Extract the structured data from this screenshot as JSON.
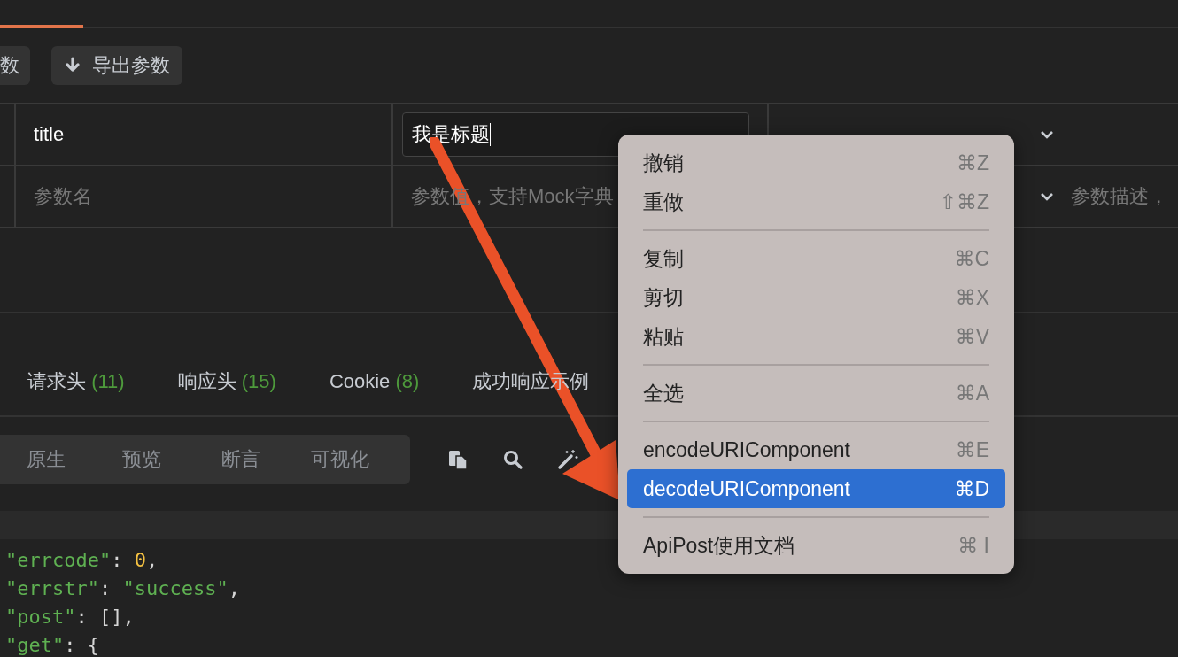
{
  "params_toolbar": {
    "buttons": [
      {
        "label": "数"
      },
      {
        "label": "导出参数"
      }
    ]
  },
  "params_table": {
    "rows": [
      {
        "kind": "filled",
        "name": "title",
        "value": "我是标题",
        "focused": true
      },
      {
        "kind": "empty",
        "name_placeholder": "参数名",
        "value_placeholder": "参数值，支持Mock字典",
        "description_placeholder": "参数描述，"
      }
    ]
  },
  "response_tabs": [
    {
      "label": "请求头",
      "count": "(11)"
    },
    {
      "label": "响应头",
      "count": "(15)"
    },
    {
      "label": "Cookie",
      "count": "(8)"
    },
    {
      "label": "成功响应示例"
    }
  ],
  "view_modes": [
    "原生",
    "预览",
    "断言",
    "可视化"
  ],
  "code_lines": [
    [
      {
        "kind": "key",
        "text": "\"errcode\""
      },
      {
        "kind": "punct",
        "text": ": "
      },
      {
        "kind": "number",
        "text": "0"
      },
      {
        "kind": "punct",
        "text": ","
      }
    ],
    [
      {
        "kind": "key",
        "text": "\"errstr\""
      },
      {
        "kind": "punct",
        "text": ": "
      },
      {
        "kind": "string",
        "text": "\"success\""
      },
      {
        "kind": "punct",
        "text": ","
      }
    ],
    [
      {
        "kind": "key",
        "text": "\"post\""
      },
      {
        "kind": "punct",
        "text": ": "
      },
      {
        "kind": "punct",
        "text": "[]"
      },
      {
        "kind": "punct",
        "text": ","
      }
    ],
    [
      {
        "kind": "key",
        "text": "\"get\""
      },
      {
        "kind": "punct",
        "text": ": {"
      }
    ]
  ],
  "context_menu": {
    "items": [
      {
        "kind": "item",
        "label": "撤销",
        "shortcut": "⌘Z",
        "selected": false
      },
      {
        "kind": "item",
        "label": "重做",
        "shortcut": "⇧⌘Z",
        "selected": false
      },
      {
        "kind": "separator"
      },
      {
        "kind": "item",
        "label": "复制",
        "shortcut": "⌘C",
        "selected": false
      },
      {
        "kind": "item",
        "label": "剪切",
        "shortcut": "⌘X",
        "selected": false
      },
      {
        "kind": "item",
        "label": "粘贴",
        "shortcut": "⌘V",
        "selected": false
      },
      {
        "kind": "separator"
      },
      {
        "kind": "item",
        "label": "全选",
        "shortcut": "⌘A",
        "selected": false
      },
      {
        "kind": "separator"
      },
      {
        "kind": "item",
        "label": "encodeURIComponent",
        "shortcut": "⌘E",
        "selected": false
      },
      {
        "kind": "item",
        "label": "decodeURIComponent",
        "shortcut": "⌘D",
        "selected": true
      },
      {
        "kind": "separator"
      },
      {
        "kind": "item",
        "label": "ApiPost使用文档",
        "shortcut": "⌘ I",
        "selected": false
      }
    ]
  }
}
